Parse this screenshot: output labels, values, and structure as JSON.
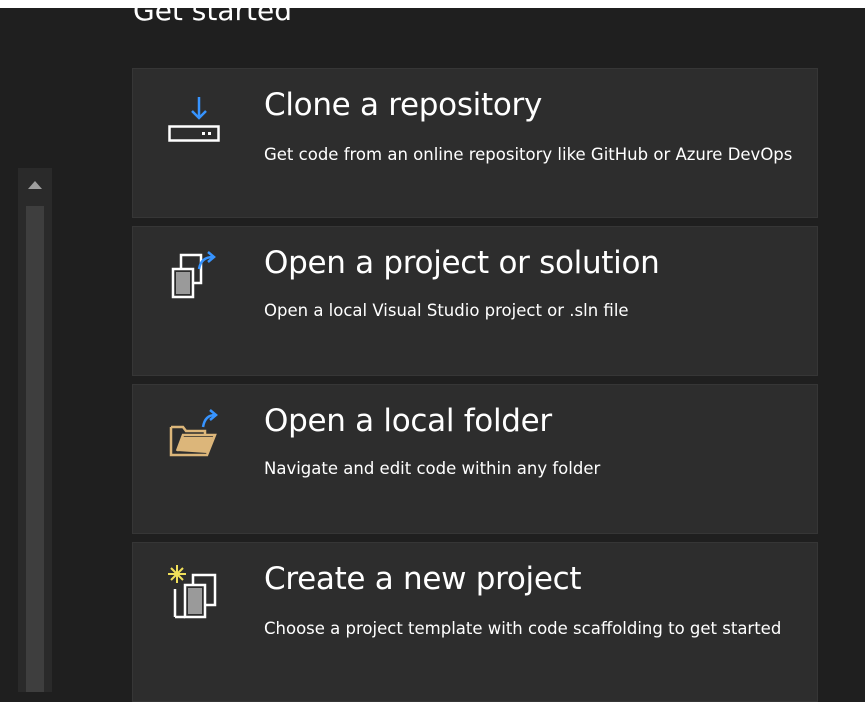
{
  "section": {
    "title": "Get started"
  },
  "cards": [
    {
      "title": "Clone a repository",
      "description": "Get code from an online repository like GitHub or Azure DevOps",
      "icon": "clone-download-icon"
    },
    {
      "title": "Open a project or solution",
      "description": "Open a local Visual Studio project or .sln file",
      "icon": "open-project-icon"
    },
    {
      "title": "Open a local folder",
      "description": "Navigate and edit code within any folder",
      "icon": "open-folder-icon"
    },
    {
      "title": "Create a new project",
      "description": "Choose a project template with code scaffolding to get started",
      "icon": "new-project-icon"
    }
  ],
  "colors": {
    "background": "#1f1f1f",
    "card": "#2d2d2d",
    "accent_blue": "#3794ff",
    "folder_yellow": "#dcb67a"
  }
}
